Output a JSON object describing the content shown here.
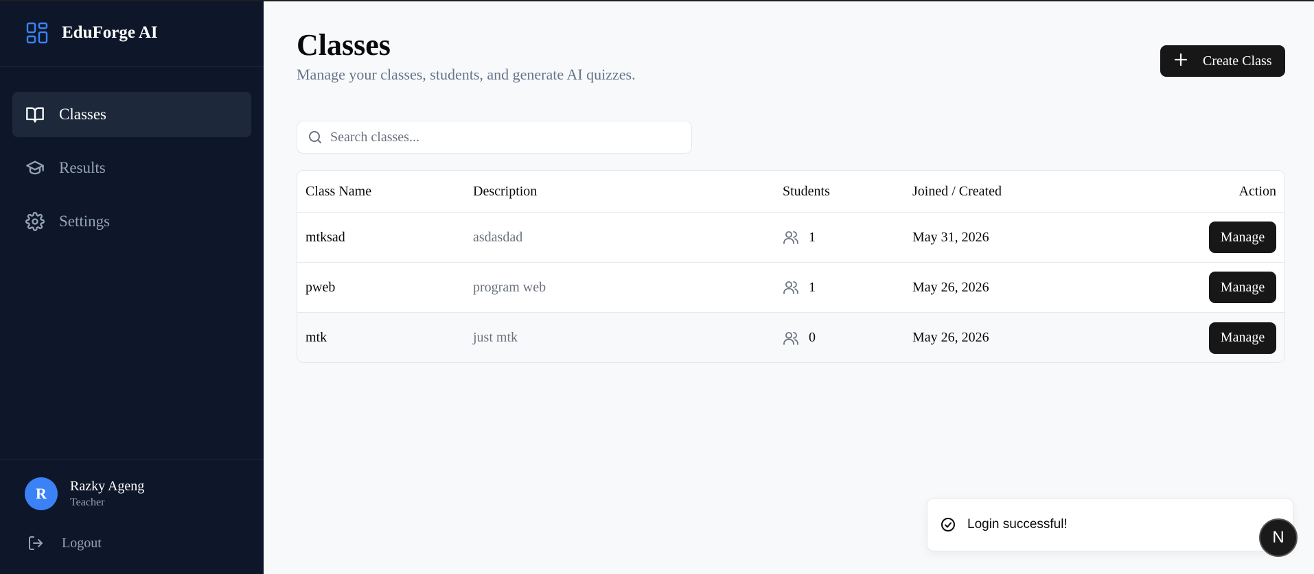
{
  "app": {
    "name": "EduForge AI"
  },
  "sidebar": {
    "items": [
      {
        "label": "Classes",
        "icon": "book-open-icon",
        "active": true
      },
      {
        "label": "Results",
        "icon": "graduation-cap-icon",
        "active": false
      },
      {
        "label": "Settings",
        "icon": "gear-icon",
        "active": false
      }
    ],
    "user": {
      "initial": "R",
      "name": "Razky Ageng",
      "role": "Teacher"
    },
    "logout_label": "Logout"
  },
  "header": {
    "title": "Classes",
    "subtitle": "Manage your classes, students, and generate AI quizzes.",
    "create_label": "Create Class"
  },
  "search": {
    "placeholder": "Search classes...",
    "value": ""
  },
  "table": {
    "columns": [
      "Class Name",
      "Description",
      "Students",
      "Joined / Created",
      "Action"
    ],
    "rows": [
      {
        "name": "mtksad",
        "description": "asdasdad",
        "students": "1",
        "date": "May 31, 2026",
        "action": "Manage"
      },
      {
        "name": "pweb",
        "description": "program web",
        "students": "1",
        "date": "May 26, 2026",
        "action": "Manage"
      },
      {
        "name": "mtk",
        "description": "just mtk",
        "students": "0",
        "date": "May 26, 2026",
        "action": "Manage"
      }
    ]
  },
  "toast": {
    "message": "Login successful!"
  },
  "dev_badge": {
    "label": "N"
  },
  "colors": {
    "sidebar_bg": "#0e172a",
    "accent": "#3b82f6",
    "button_bg": "#171717"
  }
}
